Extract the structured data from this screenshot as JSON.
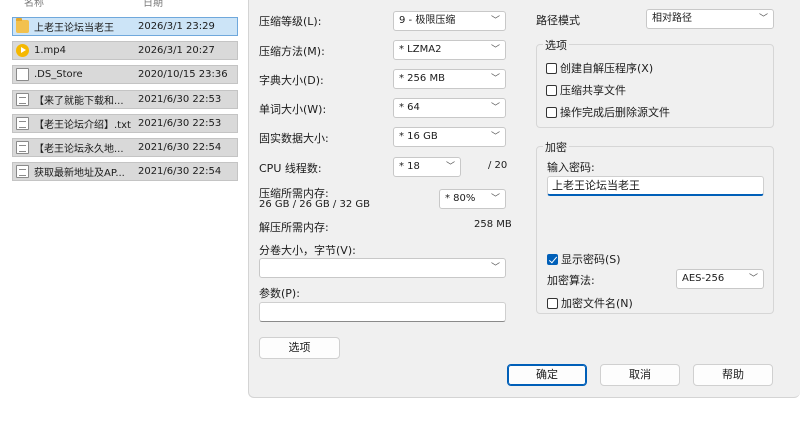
{
  "explorer": {
    "columns": {
      "name": "名称",
      "date": "日期"
    },
    "files": [
      {
        "name": "上老王论坛当老王",
        "date": "2026/3/1 23:29",
        "icon": "folder-icon",
        "selected": true
      },
      {
        "name": "1.mp4",
        "date": "2026/3/1 20:27",
        "icon": "video-file-icon",
        "selected": false
      },
      {
        "name": ".DS_Store",
        "date": "2020/10/15 23:36",
        "icon": "file-icon",
        "selected": false
      },
      {
        "name": "【来了就能下载和...",
        "date": "2021/6/30 22:53",
        "icon": "text-file-icon",
        "selected": false
      },
      {
        "name": "【老王论坛介绍】.txt",
        "date": "2021/6/30 22:53",
        "icon": "text-file-icon",
        "selected": false
      },
      {
        "name": "【老王论坛永久地...",
        "date": "2021/6/30 22:54",
        "icon": "text-file-icon",
        "selected": false
      },
      {
        "name": "获取最新地址及AP...",
        "date": "2021/6/30 22:54",
        "icon": "text-file-icon",
        "selected": false
      }
    ]
  },
  "dialog": {
    "left": {
      "compression_level": {
        "label": "压缩等级(L):",
        "value": "9 - 极限压缩"
      },
      "compression_method": {
        "label": "压缩方法(M):",
        "value": "* LZMA2"
      },
      "dictionary_size": {
        "label": "字典大小(D):",
        "value": "* 256 MB"
      },
      "word_size": {
        "label": "单词大小(W):",
        "value": "* 64"
      },
      "solid_block_size": {
        "label": "固实数据大小:",
        "value": "* 16 GB"
      },
      "cpu_threads": {
        "label": "CPU 线程数:",
        "value": "* 18",
        "total": "/ 20"
      },
      "memory_compress": {
        "label": "压缩所需内存:",
        "detail": "26 GB / 26 GB / 32 GB",
        "value": "* 80%"
      },
      "memory_decompress": {
        "label": "解压所需内存:",
        "value": "258 MB"
      },
      "split_size": {
        "label": "分卷大小，字节(V):",
        "value": ""
      },
      "parameters": {
        "label": "参数(P):",
        "value": ""
      },
      "options_button": "选项"
    },
    "right": {
      "path_mode": {
        "label": "路径模式",
        "value": "相对路径"
      },
      "options_group": {
        "title": "选项",
        "create_sfx": {
          "label": "创建自解压程序(X)",
          "checked": false
        },
        "compress_shared": {
          "label": "压缩共享文件",
          "checked": false
        },
        "delete_after": {
          "label": "操作完成后删除源文件",
          "checked": false
        }
      },
      "encryption_group": {
        "title": "加密",
        "password_label": "输入密码:",
        "password_value": "上老王论坛当老王",
        "show_password": {
          "label": "显示密码(S)",
          "checked": true
        },
        "method_label": "加密算法:",
        "method_value": "AES-256",
        "encrypt_names": {
          "label": "加密文件名(N)",
          "checked": false
        }
      }
    },
    "buttons": {
      "ok": "确定",
      "cancel": "取消",
      "help": "帮助"
    }
  },
  "colors": {
    "accent": "#005fb8",
    "selection": "#cce4f7",
    "dialog_bg": "#f0f0f0"
  }
}
